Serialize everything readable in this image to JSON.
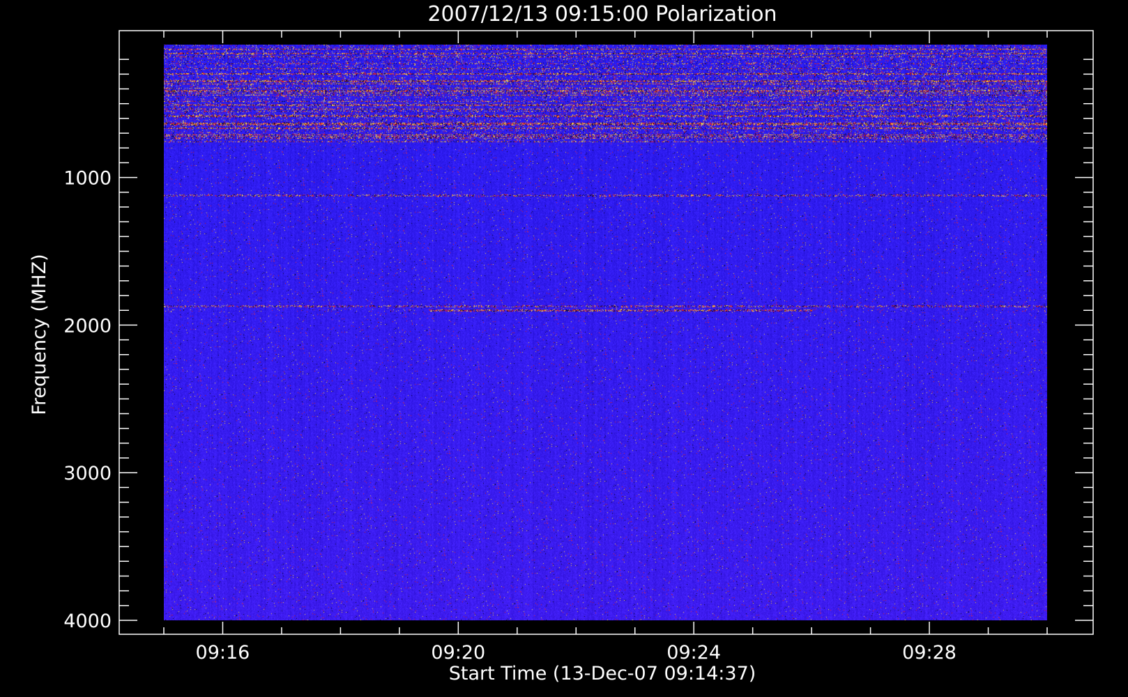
{
  "chart_data": {
    "type": "heatmap",
    "title": "2007/12/13 09:15:00 Polarization",
    "xlabel": "Start Time (13-Dec-07 09:14:37)",
    "ylabel": "Frequency (MHZ)",
    "x_range": [
      "09:15:00",
      "09:30:00"
    ],
    "y_range_mhz": [
      100,
      4000
    ],
    "y_axis_inverted": true,
    "x_ticks": [
      "09:16",
      "09:20",
      "09:24",
      "09:28"
    ],
    "y_ticks": [
      1000,
      2000,
      3000,
      4000
    ],
    "colors": {
      "background": "#000000",
      "foreground": "#ffffff",
      "base_blue": "#2a1cf0",
      "low_dark": "#0a0520",
      "mid_red": "#e0202a",
      "high_yellow": "#ffd840"
    },
    "features": [
      {
        "band_mhz": [
          100,
          760
        ],
        "description_level": "strong interference (mixed dark/red/yellow)"
      },
      {
        "band_mhz": 410,
        "level": "high"
      },
      {
        "band_mhz": 580,
        "level": "high"
      },
      {
        "band_mhz": 640,
        "level": "high"
      },
      {
        "band_mhz": 1120,
        "level": "medium"
      },
      {
        "band_mhz": 1870,
        "level": "medium"
      },
      {
        "band_mhz": 1900,
        "level": "high",
        "time_range": [
          "09:19:30",
          "09:26:00"
        ]
      }
    ],
    "grid": false,
    "legend": "none"
  }
}
